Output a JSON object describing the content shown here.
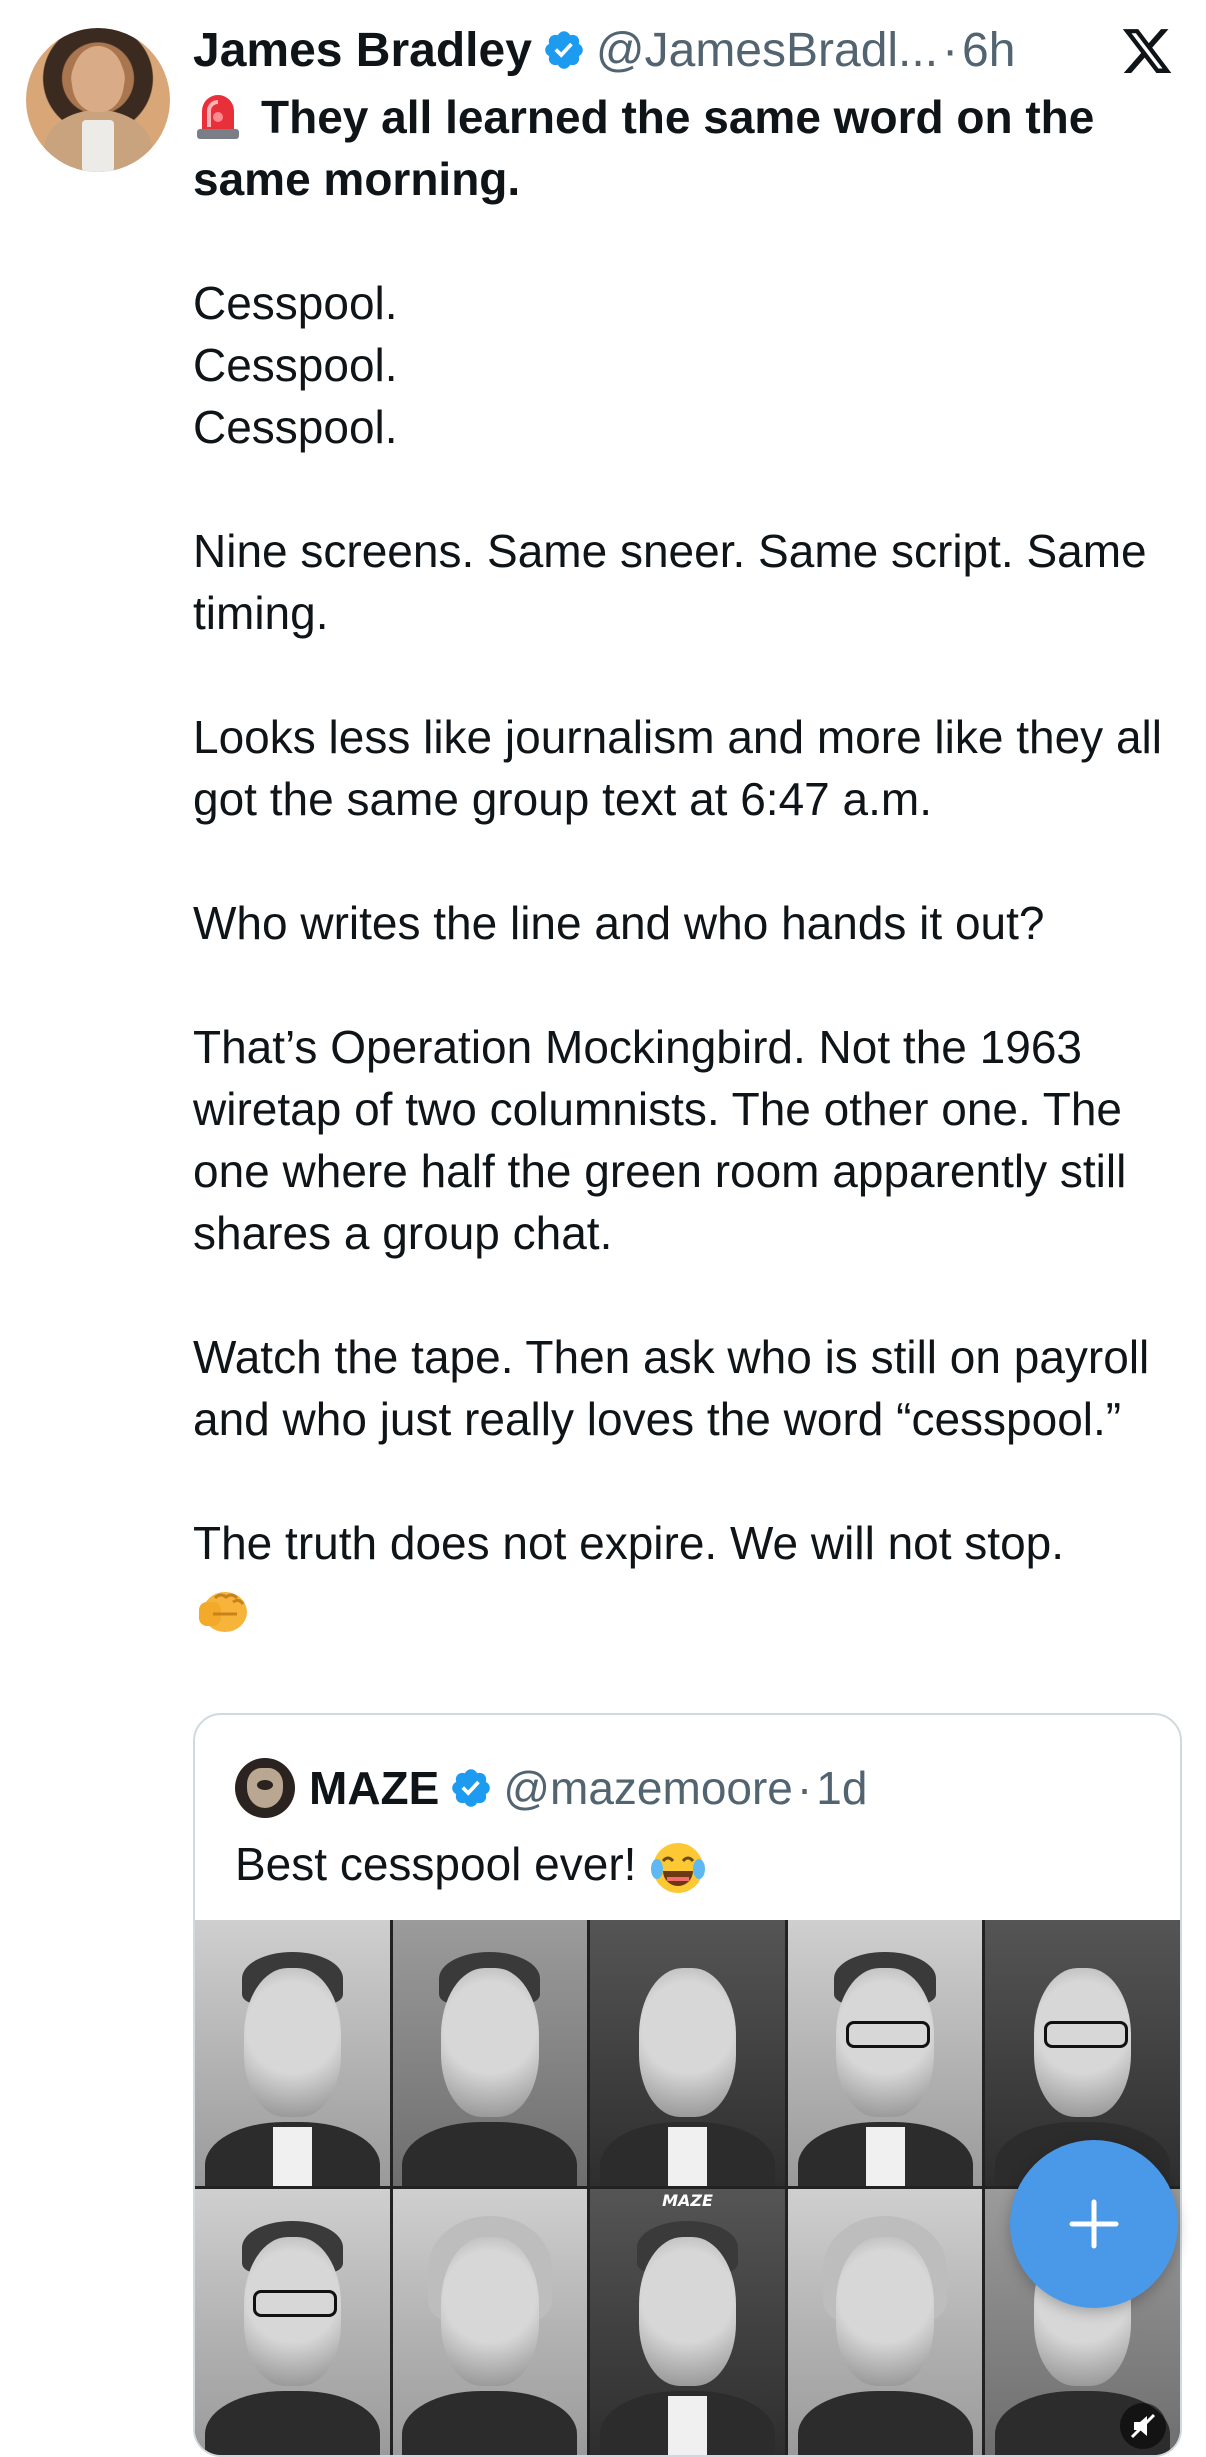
{
  "post": {
    "author_name": "James Bradley",
    "author_handle": "@JamesBradl...",
    "separator": "·",
    "timestamp": "6h",
    "avatar_icon": "profile-photo",
    "verified_icon": "verified-badge-icon",
    "headline": "They all learned the same word on the same morning.",
    "lines": [
      "Cesspool.",
      "Cesspool.",
      "Cesspool."
    ],
    "paragraph_1": "Nine screens. Same sneer. Same script. Same timing.",
    "paragraph_2": "Looks less like journalism and more like they all got the same group text at 6:47 a.m.",
    "paragraph_3": "Who writes the line and who hands it out?",
    "paragraph_4": "That’s Operation Mockingbird. Not the 1963 wiretap of two columnists. The other one. The one where half the green room apparently still shares a group chat.",
    "paragraph_5": "Watch the tape. Then ask who is still on payroll and who just really loves the word “cesspool.”",
    "paragraph_6": "The truth does not expire. We will not stop.",
    "closing_emoji": "fist-bump-emoji"
  },
  "quoted_post": {
    "author_name": "MAZE",
    "author_handle": "@mazemoore",
    "separator": "·",
    "timestamp": "1d",
    "text": "Best cesspool ever!",
    "text_emoji": "laughing-tears-emoji",
    "image_label": "MAZE"
  },
  "colors": {
    "primary_text": "#0f1419",
    "secondary_text": "#536471",
    "accent": "#1d9bf0",
    "fab": "#4a99e9",
    "card_border": "#cfd9de"
  },
  "icons": {
    "close": "x-logo-icon",
    "compose": "plus-icon",
    "mute": "mute-icon"
  }
}
